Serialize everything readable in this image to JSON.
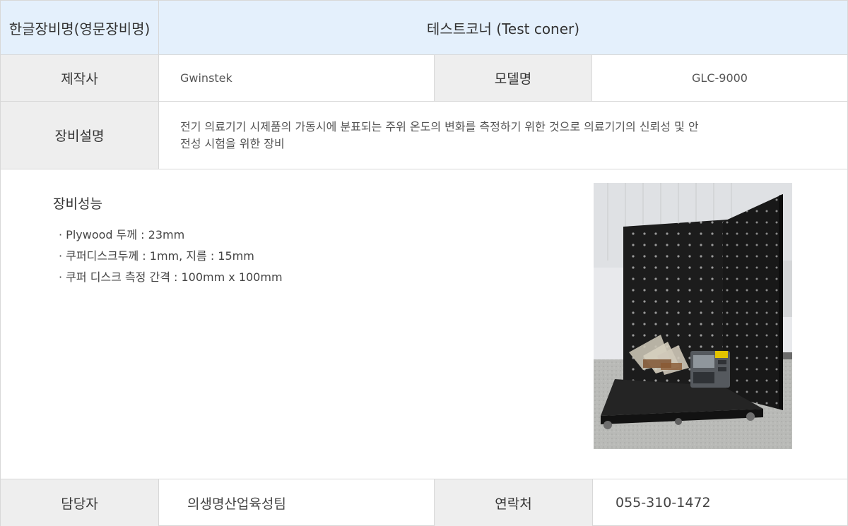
{
  "header": {
    "label": "한글장비명(영문장비명)",
    "value": "테스트코너 (Test coner)"
  },
  "maker": {
    "label": "제작사",
    "value": "Gwinstek"
  },
  "model": {
    "label": "모델명",
    "value": "GLC-9000"
  },
  "description": {
    "label": "장비설명",
    "value": "전기 의료기기 시제품의 가동시에 분표되는 주위 온도의 변화를 측정하기 위한 것으로 의료기기의 신뢰성 및 안전성 시험을 위한 장비"
  },
  "performance": {
    "title": "장비성능",
    "items": [
      "Plywood 두께 : 23mm",
      "쿠퍼디스크두께 : 1mm, 지름 : 15mm",
      "쿠퍼 디스크 측정 간격 : 100mm x 100mm"
    ]
  },
  "contact_person": {
    "label": "담당자",
    "value": "의생명산업육성팀"
  },
  "contact_phone": {
    "label": "연락처",
    "value": "055-310-1472"
  }
}
